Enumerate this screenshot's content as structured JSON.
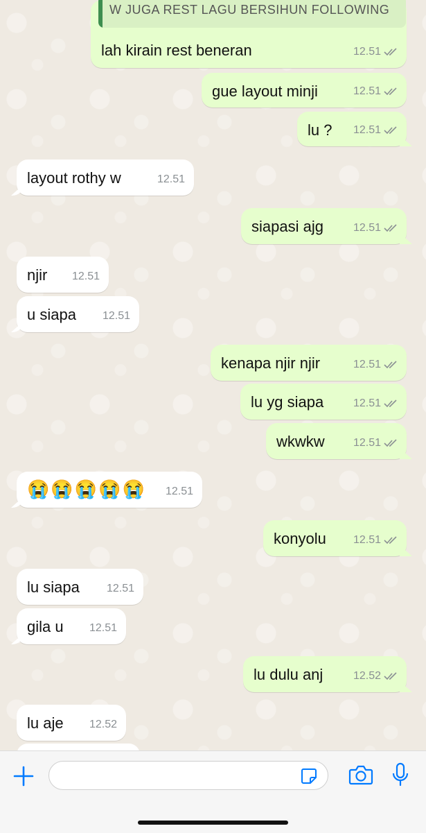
{
  "quoted_message": "W JUGA REST LAGU BERSIHUN FOLLOWING",
  "messages": [
    {
      "text": "lah kirain rest beneran",
      "time": "12.51",
      "dir": "out"
    },
    {
      "text": "gue layout minji",
      "time": "12.51",
      "dir": "out"
    },
    {
      "text": "lu ?",
      "time": "12.51",
      "dir": "out"
    },
    {
      "text": "layout rothy w",
      "time": "12.51",
      "dir": "in"
    },
    {
      "text": "siapasi ajg",
      "time": "12.51",
      "dir": "out"
    },
    {
      "text": "njir",
      "time": "12.51",
      "dir": "in"
    },
    {
      "text": "u siapa",
      "time": "12.51",
      "dir": "in"
    },
    {
      "text": "kenapa njir njir",
      "time": "12.51",
      "dir": "out"
    },
    {
      "text": "lu yg siapa",
      "time": "12.51",
      "dir": "out"
    },
    {
      "text": "wkwkw",
      "time": "12.51",
      "dir": "out"
    },
    {
      "text": "😭😭😭😭😭",
      "time": "12.51",
      "dir": "in"
    },
    {
      "text": "konyolu",
      "time": "12.51",
      "dir": "out"
    },
    {
      "text": "lu siapa",
      "time": "12.51",
      "dir": "in"
    },
    {
      "text": "gila u",
      "time": "12.51",
      "dir": "in"
    },
    {
      "text": "lu dulu anj",
      "time": "12.52",
      "dir": "out"
    },
    {
      "text": "lu aje",
      "time": "12.52",
      "dir": "in"
    }
  ],
  "composer": {
    "placeholder": "",
    "icons": [
      "plus-icon",
      "sticker-icon",
      "camera-icon",
      "microphone-icon"
    ]
  },
  "colors": {
    "outgoing_bubble": "#e6fecd",
    "incoming_bubble": "#ffffff",
    "accent": "#007aff",
    "read_ticks": "#8a8f93",
    "chat_background": "#efeae2"
  }
}
